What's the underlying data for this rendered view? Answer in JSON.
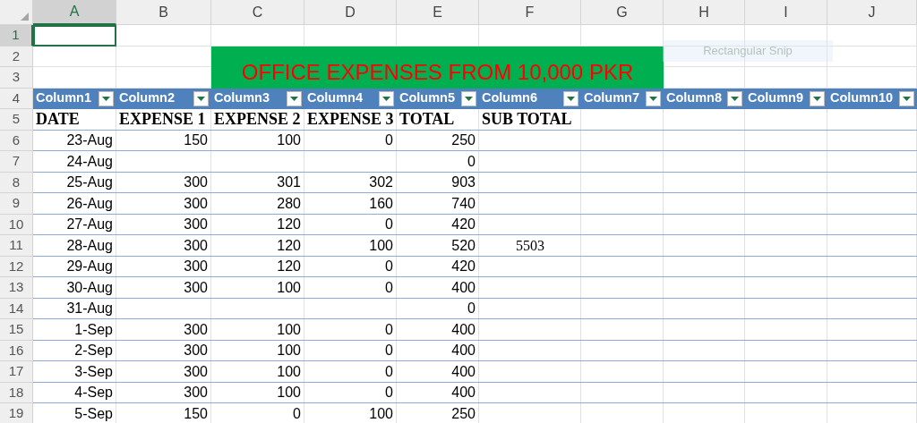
{
  "column_headers": [
    {
      "label": "A",
      "selected": true
    },
    {
      "label": "B",
      "selected": false
    },
    {
      "label": "C",
      "selected": false
    },
    {
      "label": "D",
      "selected": false
    },
    {
      "label": "E",
      "selected": false
    },
    {
      "label": "F",
      "selected": false
    },
    {
      "label": "G",
      "selected": false
    },
    {
      "label": "H",
      "selected": false
    },
    {
      "label": "I",
      "selected": false
    },
    {
      "label": "J",
      "selected": false
    }
  ],
  "row_headers": [
    {
      "label": "1",
      "selected": true
    },
    {
      "label": "2",
      "selected": false
    },
    {
      "label": "3",
      "selected": false
    },
    {
      "label": "4",
      "selected": false
    },
    {
      "label": "5",
      "selected": false
    },
    {
      "label": "6",
      "selected": false
    },
    {
      "label": "7",
      "selected": false
    },
    {
      "label": "8",
      "selected": false
    },
    {
      "label": "9",
      "selected": false
    },
    {
      "label": "10",
      "selected": false
    },
    {
      "label": "11",
      "selected": false
    },
    {
      "label": "12",
      "selected": false
    },
    {
      "label": "13",
      "selected": false
    },
    {
      "label": "14",
      "selected": false
    },
    {
      "label": "15",
      "selected": false
    },
    {
      "label": "16",
      "selected": false
    },
    {
      "label": "17",
      "selected": false
    },
    {
      "label": "18",
      "selected": false
    },
    {
      "label": "19",
      "selected": false
    }
  ],
  "title_banner": {
    "text": "OFFICE EXPENSES FROM 10,000 PKR"
  },
  "tooltip": {
    "text": "Rectangular Snip"
  },
  "table": {
    "columns": [
      "Column1",
      "Column2",
      "Column3",
      "Column4",
      "Column5",
      "Column6",
      "Column7",
      "Column8",
      "Column9",
      "Column10"
    ],
    "heading_row": [
      "DATE",
      "EXPENSE 1",
      "EXPENSE 2",
      "EXPENSE 3",
      "TOTAL",
      "SUB TOTAL"
    ],
    "rows": [
      {
        "date": "23-Aug",
        "expense_1": "150",
        "expense_2": "100",
        "expense_3": "0",
        "total": "250"
      },
      {
        "date": "24-Aug",
        "total": "0"
      },
      {
        "date": "25-Aug",
        "expense_1": "300",
        "expense_2": "301",
        "expense_3": "302",
        "total": "903"
      },
      {
        "date": "26-Aug",
        "expense_1": "300",
        "expense_2": "280",
        "expense_3": "160",
        "total": "740"
      },
      {
        "date": "27-Aug",
        "expense_1": "300",
        "expense_2": "120",
        "expense_3": "0",
        "total": "420"
      },
      {
        "date": "28-Aug",
        "expense_1": "300",
        "expense_2": "120",
        "expense_3": "100",
        "total": "520",
        "sub_total": "5503"
      },
      {
        "date": "29-Aug",
        "expense_1": "300",
        "expense_2": "120",
        "expense_3": "0",
        "total": "420"
      },
      {
        "date": "30-Aug",
        "expense_1": "300",
        "expense_2": "100",
        "expense_3": "0",
        "total": "400"
      },
      {
        "date": "31-Aug",
        "total": "0"
      },
      {
        "date": "1-Sep",
        "expense_1": "300",
        "expense_2": "100",
        "expense_3": "0",
        "total": "400"
      },
      {
        "date": "2-Sep",
        "expense_1": "300",
        "expense_2": "100",
        "expense_3": "0",
        "total": "400"
      },
      {
        "date": "3-Sep",
        "expense_1": "300",
        "expense_2": "100",
        "expense_3": "0",
        "total": "400"
      },
      {
        "date": "4-Sep",
        "expense_1": "300",
        "expense_2": "100",
        "expense_3": "0",
        "total": "400"
      },
      {
        "date": "5-Sep",
        "expense_1": "150",
        "expense_2": "0",
        "expense_3": "100",
        "total": "250"
      }
    ]
  }
}
